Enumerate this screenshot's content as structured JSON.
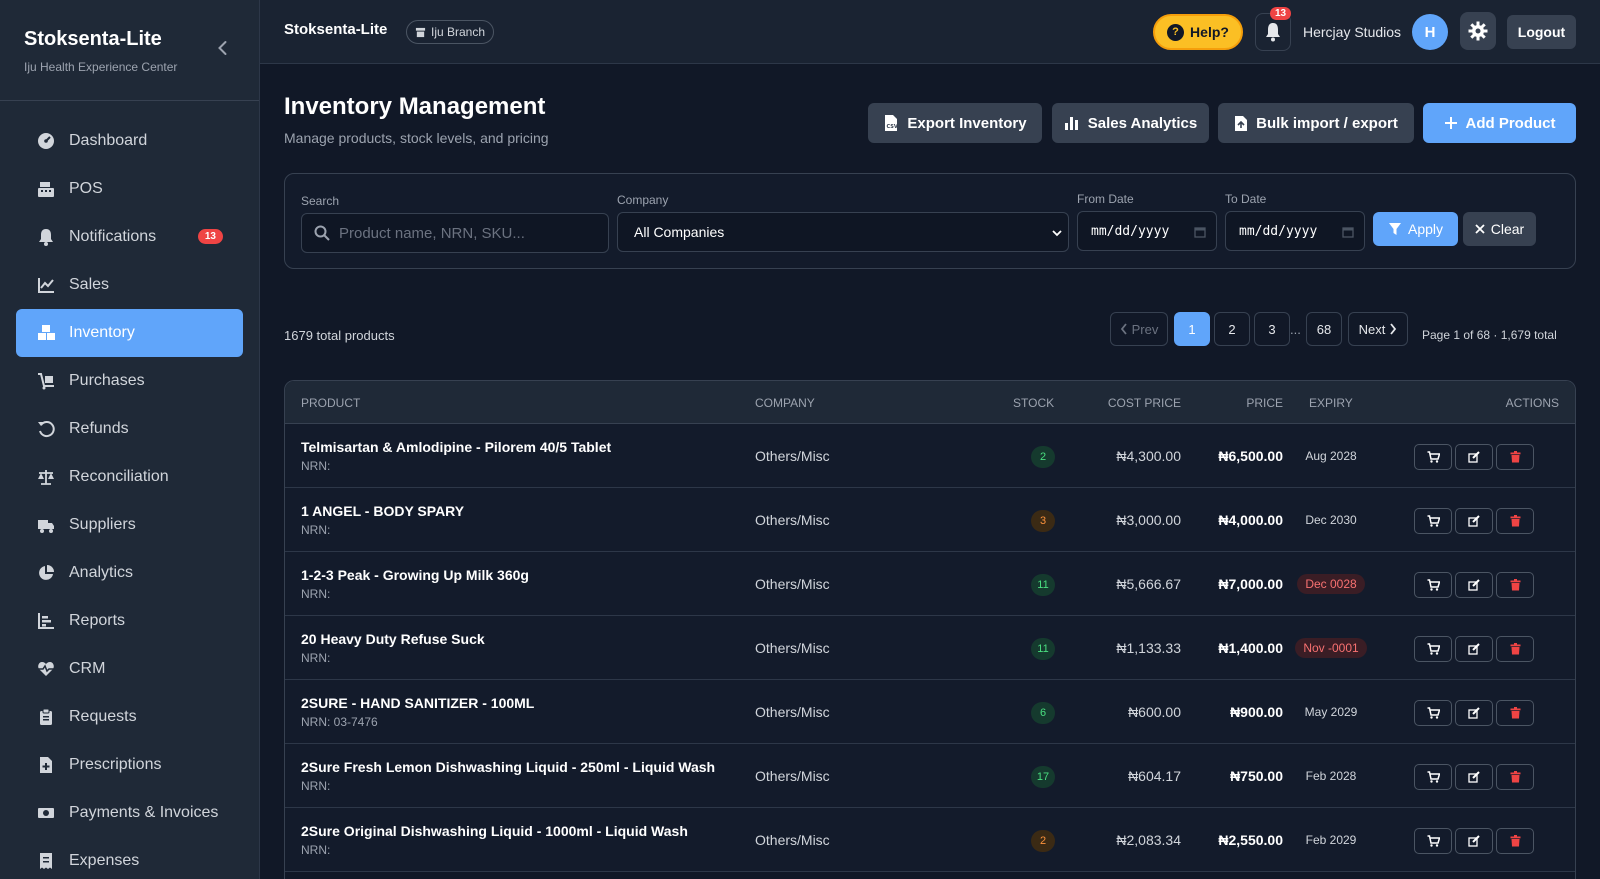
{
  "sidebar": {
    "brand_title": "Stoksenta-Lite",
    "brand_subtitle": "Iju Health Experience Center",
    "items": [
      {
        "label": "Dashboard",
        "icon": "dashboard-icon"
      },
      {
        "label": "POS",
        "icon": "cash-register-icon"
      },
      {
        "label": "Notifications",
        "icon": "bell-icon",
        "badge": "13"
      },
      {
        "label": "Sales",
        "icon": "line-chart-icon"
      },
      {
        "label": "Inventory",
        "icon": "boxes-icon",
        "active": true
      },
      {
        "label": "Purchases",
        "icon": "dolly-icon"
      },
      {
        "label": "Refunds",
        "icon": "undo-icon"
      },
      {
        "label": "Reconciliation",
        "icon": "scale-icon"
      },
      {
        "label": "Suppliers",
        "icon": "truck-icon"
      },
      {
        "label": "Analytics",
        "icon": "pie-chart-icon"
      },
      {
        "label": "Reports",
        "icon": "bar-chart-icon"
      },
      {
        "label": "CRM",
        "icon": "heart-pulse-icon"
      },
      {
        "label": "Requests",
        "icon": "clipboard-icon"
      },
      {
        "label": "Prescriptions",
        "icon": "file-medical-icon"
      },
      {
        "label": "Payments & Invoices",
        "icon": "money-icon"
      },
      {
        "label": "Expenses",
        "icon": "receipt-icon"
      }
    ]
  },
  "topbar": {
    "title": "Stoksenta-Lite",
    "branch": "Iju Branch",
    "help_label": "Help?",
    "notification_count": "13",
    "user_name": "Hercjay Studios",
    "avatar_initial": "H",
    "logout_label": "Logout"
  },
  "page": {
    "title": "Inventory Management",
    "subtitle": "Manage products, stock levels, and pricing",
    "buttons": {
      "export": "Export Inventory",
      "analytics": "Sales Analytics",
      "bulk": "Bulk import / export",
      "add": "Add Product"
    }
  },
  "filters": {
    "search_label": "Search",
    "search_placeholder": "Product name, NRN, SKU...",
    "company_label": "Company",
    "company_value": "All Companies",
    "from_label": "From Date",
    "to_label": "To Date",
    "date_placeholder": "mm/dd/yyyy",
    "apply_label": "Apply",
    "clear_label": "Clear"
  },
  "pagination": {
    "total_text": "1679 total products",
    "prev": "Prev",
    "pages": [
      "1",
      "2",
      "3"
    ],
    "ellipsis": "...",
    "last": "68",
    "next": "Next",
    "info": "Page 1 of 68 · 1,679 total"
  },
  "table": {
    "columns": {
      "product": "Product",
      "company": "Company",
      "stock": "Stock",
      "cost": "Cost Price",
      "price": "Price",
      "expiry": "Expiry",
      "actions": "Actions"
    },
    "rows": [
      {
        "name": "Telmisartan & Amlodipine - Pilorem 40/5 Tablet",
        "nrn": "NRN:",
        "company": "Others/Misc",
        "stock": "2",
        "stock_level": "green",
        "cost": "₦4,300.00",
        "price": "₦6,500.00",
        "expiry": "Aug 2028",
        "expired": false
      },
      {
        "name": "1 ANGEL - BODY SPARY",
        "nrn": "NRN:",
        "company": "Others/Misc",
        "stock": "3",
        "stock_level": "orange",
        "cost": "₦3,000.00",
        "price": "₦4,000.00",
        "expiry": "Dec 2030",
        "expired": false
      },
      {
        "name": "1-2-3 Peak - Growing Up Milk 360g",
        "nrn": "NRN:",
        "company": "Others/Misc",
        "stock": "11",
        "stock_level": "green",
        "cost": "₦5,666.67",
        "price": "₦7,000.00",
        "expiry": "Dec 0028",
        "expired": true
      },
      {
        "name": "20 Heavy Duty Refuse Suck",
        "nrn": "NRN:",
        "company": "Others/Misc",
        "stock": "11",
        "stock_level": "green",
        "cost": "₦1,133.33",
        "price": "₦1,400.00",
        "expiry": "Nov -0001",
        "expired": true
      },
      {
        "name": "2SURE - HAND SANITIZER - 100ML",
        "nrn": "NRN: 03-7476",
        "company": "Others/Misc",
        "stock": "6",
        "stock_level": "green",
        "cost": "₦600.00",
        "price": "₦900.00",
        "expiry": "May 2029",
        "expired": false
      },
      {
        "name": "2Sure Fresh Lemon Dishwashing Liquid - 250ml - Liquid Wash",
        "nrn": "NRN:",
        "company": "Others/Misc",
        "stock": "17",
        "stock_level": "green",
        "cost": "₦604.17",
        "price": "₦750.00",
        "expiry": "Feb 2028",
        "expired": false
      },
      {
        "name": "2Sure Original Dishwashing Liquid - 1000ml - Liquid Wash",
        "nrn": "NRN:",
        "company": "Others/Misc",
        "stock": "2",
        "stock_level": "orange",
        "cost": "₦2,083.34",
        "price": "₦2,550.00",
        "expiry": "Feb 2029",
        "expired": false
      }
    ]
  },
  "colors": {
    "accent": "#60a5fa",
    "danger": "#ef4444",
    "help": "#fbbf24",
    "background": "#111827",
    "sidebar": "#1f2937"
  }
}
